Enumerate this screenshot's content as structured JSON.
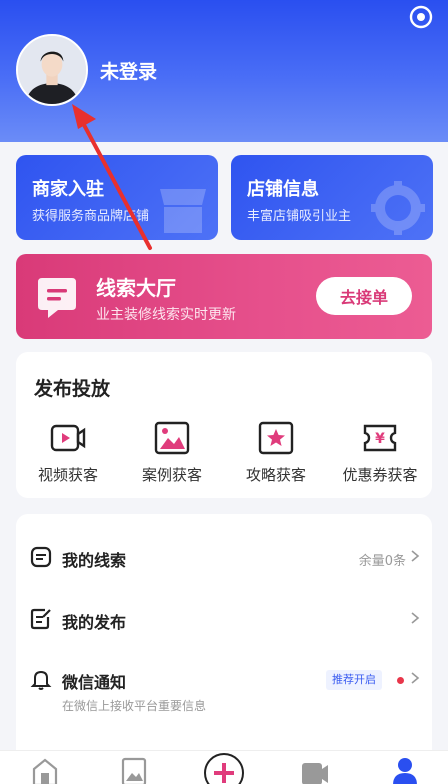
{
  "header": {
    "login_text": "未登录"
  },
  "cards": {
    "merchant": {
      "title": "商家入驻",
      "subtitle": "获得服务商品牌店铺"
    },
    "store": {
      "title": "店铺信息",
      "subtitle": "丰富店铺吸引业主"
    },
    "leads_hall": {
      "title": "线索大厅",
      "subtitle": "业主装修线索实时更新",
      "button": "去接单"
    }
  },
  "publish": {
    "title": "发布投放",
    "items": [
      {
        "label": "视频获客",
        "icon": "video-icon"
      },
      {
        "label": "案例获客",
        "icon": "image-icon"
      },
      {
        "label": "攻略获客",
        "icon": "star-icon"
      },
      {
        "label": "优惠券获客",
        "icon": "coupon-icon"
      }
    ]
  },
  "list": {
    "leads": {
      "label": "我的线索",
      "right": "余量0条"
    },
    "posts": {
      "label": "我的发布"
    },
    "wechat": {
      "label": "微信通知",
      "badge": "推荐开启",
      "sub": "在微信上接收平台重要信息"
    }
  },
  "colors": {
    "header_blue": "#2a4ff0",
    "pink": "#d93a78",
    "arrow_red": "#e8302e"
  }
}
